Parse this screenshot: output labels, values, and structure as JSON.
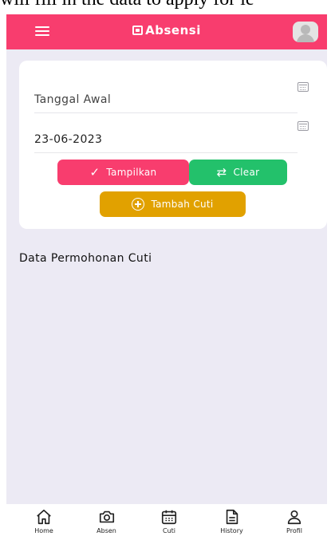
{
  "caption": "will fill in the data to apply for le",
  "appbar": {
    "brand": "Absensi",
    "accent": "#f83d6e"
  },
  "form": {
    "start_date_placeholder": "Tanggal Awal",
    "end_date_value": "23-06-2023"
  },
  "buttons": {
    "show_label": "Tampilkan",
    "show_color": "#f83d6e",
    "clear_label": "Clear",
    "clear_color": "#23c16b",
    "add_label": "Tambah Cuti",
    "add_color": "#e1a100"
  },
  "section": {
    "title": "Data Permohonan Cuti"
  },
  "nav": {
    "items": [
      {
        "label": "Home",
        "icon": "home-icon"
      },
      {
        "label": "Absen",
        "icon": "camera-icon"
      },
      {
        "label": "Cuti",
        "icon": "calendar-icon"
      },
      {
        "label": "History",
        "icon": "document-icon"
      },
      {
        "label": "Profil",
        "icon": "user-icon"
      }
    ]
  }
}
